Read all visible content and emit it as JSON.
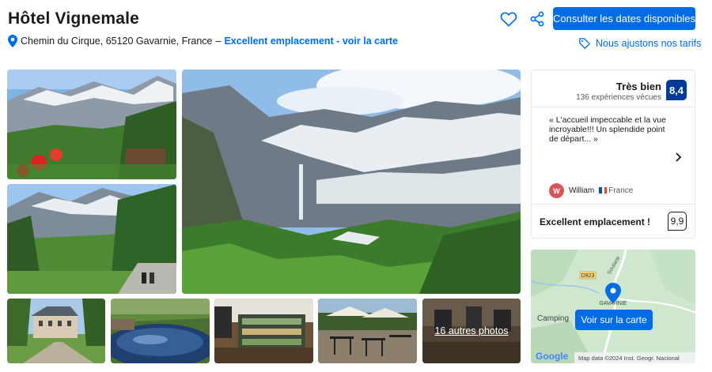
{
  "hotel": {
    "name": "Hôtel Vignemale",
    "address": "Chemin du Cirque, 65120 Gavarnie, France",
    "address_sep": "–",
    "location_link": "Excellent emplacement - voir la carte"
  },
  "actions": {
    "cta_label": "Consulter les dates disponibles",
    "price_match_label": "Nous ajustons nos tarifs",
    "heart_icon": "heart-icon",
    "share_icon": "share-icon"
  },
  "gallery": {
    "more_photos_label": "16 autres photos",
    "photo_count_shown": 8
  },
  "review": {
    "label": "Très bien",
    "count_text": "136 expériences vécues",
    "score": "8,4",
    "quote": "« L'accueil impeccable et la vue incroyable!!! Un splendide point de départ... »",
    "user_initial": "W",
    "user_name": "William",
    "user_country": "France",
    "location_label": "Excellent emplacement !",
    "location_score": "9,9"
  },
  "map": {
    "button_label": "Voir sur la carte",
    "road_label": "D923",
    "town_label": "GAVARNIE",
    "camping_label": "Camping",
    "side_label": "Soulane",
    "provider_label": "Google",
    "attribution": "Map data ©2024 Inst. Geogr. Nacional"
  },
  "colors": {
    "brand_blue": "#006ce4",
    "score_navy": "#003b95",
    "avatar_red": "#d4555a"
  }
}
